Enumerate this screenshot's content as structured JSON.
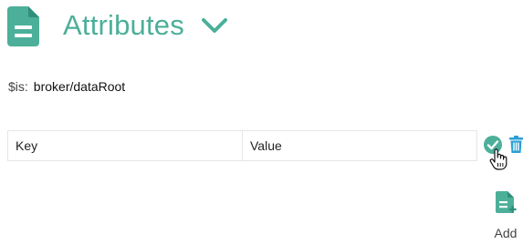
{
  "header": {
    "title": "Attributes",
    "icon": "document-icon",
    "toggle_icon": "chevron-down-icon",
    "accent_color": "#4caf99"
  },
  "is_line": {
    "label": "$is:",
    "value": "broker/dataRoot"
  },
  "attribute_row": {
    "key_placeholder": "Key",
    "value_placeholder": "Value",
    "confirm_icon": "check-circle-icon",
    "delete_icon": "trash-icon",
    "confirm_color": "#4caf99",
    "delete_color": "#2a9fd6"
  },
  "add": {
    "label": "Add",
    "icon": "add-document-icon"
  }
}
